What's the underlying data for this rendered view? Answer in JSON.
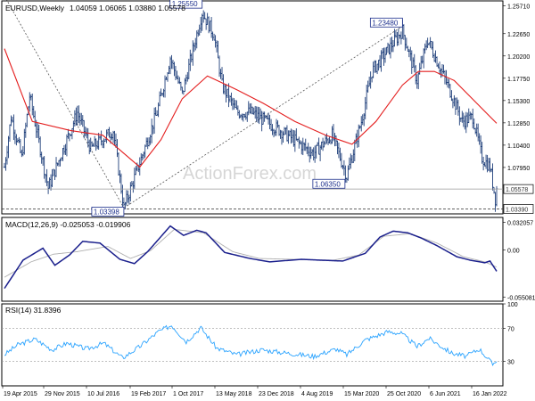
{
  "chart_data": [
    {
      "type": "ohlc",
      "title": "EURUSD,Weekly",
      "ohlc_header": "1.04059 1.06065 1.03880 1.05578",
      "ylim": [
        1.0285,
        1.2625
      ],
      "y_ticks": [
        "1.25710",
        "1.22650",
        "1.20200",
        "1.17750",
        "1.15300",
        "1.12850",
        "1.10400",
        "1.07950"
      ],
      "last_price": "1.05578",
      "horizontal_line": "1.03390",
      "x_ticks": [
        "19 Apr 2015",
        "29 Nov 2015",
        "10 Jul 2016",
        "19 Feb 2017",
        "1 Oct 2017",
        "13 May 2018",
        "23 Dec 2018",
        "4 Aug 2019",
        "15 Mar 2020",
        "25 Oct 2020",
        "6 Jun 2021",
        "16 Jan 2022"
      ],
      "annotations": [
        {
          "label": "1.25550",
          "date": "2018-02-18",
          "value": 1.2555
        },
        {
          "label": "1.23480",
          "date": "2021-01-10",
          "value": 1.2348
        },
        {
          "label": "1.06350",
          "date": "2020-03-22",
          "value": 1.0635
        },
        {
          "label": "1.03398",
          "date": "2017-01-01",
          "value": 1.03398
        }
      ],
      "price_path": [
        [
          "2015-04-12",
          1.08
        ],
        [
          "2015-05-17",
          1.135
        ],
        [
          "2015-07-12",
          1.09
        ],
        [
          "2015-08-23",
          1.158
        ],
        [
          "2015-11-29",
          1.057
        ],
        [
          "2016-05-01",
          1.14
        ],
        [
          "2016-07-10",
          1.1
        ],
        [
          "2016-11-06",
          1.12
        ],
        [
          "2017-01-01",
          1.035
        ],
        [
          "2017-03-26",
          1.085
        ],
        [
          "2017-06-25",
          1.14
        ],
        [
          "2017-09-03",
          1.2
        ],
        [
          "2017-11-05",
          1.16
        ],
        [
          "2018-02-18",
          1.25
        ],
        [
          "2018-04-22",
          1.225
        ],
        [
          "2018-06-03",
          1.17
        ],
        [
          "2018-08-19",
          1.14
        ],
        [
          "2018-11-04",
          1.14
        ],
        [
          "2019-04-07",
          1.12
        ],
        [
          "2019-09-29",
          1.095
        ],
        [
          "2020-01-05",
          1.115
        ],
        [
          "2020-03-22",
          1.07
        ],
        [
          "2020-06-07",
          1.13
        ],
        [
          "2020-08-02",
          1.185
        ],
        [
          "2021-01-10",
          1.23
        ],
        [
          "2021-03-28",
          1.175
        ],
        [
          "2021-05-23",
          1.22
        ],
        [
          "2021-09-26",
          1.16
        ],
        [
          "2021-11-21",
          1.13
        ],
        [
          "2022-01-16",
          1.135
        ],
        [
          "2022-03-06",
          1.09
        ],
        [
          "2022-04-17",
          1.08
        ],
        [
          "2022-05-15",
          1.045
        ],
        [
          "2022-05-22",
          1.05578
        ]
      ],
      "ma_path": [
        [
          "2015-04-12",
          1.21
        ],
        [
          "2015-09-06",
          1.13
        ],
        [
          "2016-03-27",
          1.12
        ],
        [
          "2016-09-11",
          1.115
        ],
        [
          "2017-03-26",
          1.08
        ],
        [
          "2017-07-16",
          1.11
        ],
        [
          "2017-11-05",
          1.155
        ],
        [
          "2018-03-18",
          1.18
        ],
        [
          "2018-08-19",
          1.165
        ],
        [
          "2019-01-06",
          1.15
        ],
        [
          "2019-06-23",
          1.13
        ],
        [
          "2019-12-01",
          1.115
        ],
        [
          "2020-04-19",
          1.105
        ],
        [
          "2020-08-23",
          1.13
        ],
        [
          "2021-01-10",
          1.17
        ],
        [
          "2021-04-04",
          1.185
        ],
        [
          "2021-06-27",
          1.185
        ],
        [
          "2021-10-10",
          1.175
        ],
        [
          "2022-02-06",
          1.15
        ],
        [
          "2022-05-22",
          1.128
        ]
      ],
      "trend_lines": [
        {
          "from": [
            "2015-04-12",
            1.268
          ],
          "to": [
            "2017-01-01",
            1.035
          ]
        },
        {
          "from": [
            "2017-01-01",
            1.035
          ],
          "to": [
            "2021-01-10",
            1.2348
          ]
        }
      ]
    },
    {
      "type": "line",
      "title": "MACD(12,26,9) -0.025053 -0.019906",
      "y_ticks": [
        "0.032057",
        "0.00",
        "-0.055081"
      ],
      "ylim": [
        -0.06,
        0.038
      ],
      "series": [
        {
          "values": [
            [
              "2015-04-12",
              -0.045
            ],
            [
              "2015-07-19",
              -0.012
            ],
            [
              "2015-11-01",
              0.002
            ],
            [
              "2016-01-03",
              -0.018
            ],
            [
              "2016-03-20",
              -0.006
            ],
            [
              "2016-05-29",
              0.01
            ],
            [
              "2016-08-28",
              0.008
            ],
            [
              "2016-12-11",
              -0.011
            ],
            [
              "2017-02-26",
              -0.016
            ],
            [
              "2017-05-07",
              -0.002
            ],
            [
              "2017-09-03",
              0.028
            ],
            [
              "2017-11-12",
              0.017
            ],
            [
              "2018-01-21",
              0.023
            ],
            [
              "2018-03-11",
              0.02
            ],
            [
              "2018-06-17",
              -0.003
            ],
            [
              "2018-10-28",
              -0.01
            ],
            [
              "2019-02-10",
              -0.014
            ],
            [
              "2019-07-28",
              -0.011
            ],
            [
              "2019-11-03",
              -0.012
            ],
            [
              "2020-03-01",
              -0.013
            ],
            [
              "2020-06-28",
              -0.004
            ],
            [
              "2020-09-13",
              0.015
            ],
            [
              "2020-11-22",
              0.022
            ],
            [
              "2021-02-07",
              0.02
            ],
            [
              "2021-04-18",
              0.014
            ],
            [
              "2021-07-11",
              0.005
            ],
            [
              "2021-10-24",
              -0.008
            ],
            [
              "2022-01-02",
              -0.012
            ],
            [
              "2022-03-20",
              -0.015
            ],
            [
              "2022-04-17",
              -0.013
            ],
            [
              "2022-05-22",
              -0.025
            ]
          ]
        },
        {
          "values": [
            [
              "2015-04-12",
              -0.032
            ],
            [
              "2015-08-30",
              -0.014
            ],
            [
              "2015-12-27",
              -0.005
            ],
            [
              "2016-05-01",
              -0.002
            ],
            [
              "2016-10-09",
              0.004
            ],
            [
              "2017-02-05",
              -0.01
            ],
            [
              "2017-05-21",
              -0.001
            ],
            [
              "2017-09-24",
              0.024
            ],
            [
              "2018-02-25",
              0.02
            ],
            [
              "2018-07-29",
              -0.002
            ],
            [
              "2018-12-16",
              -0.01
            ],
            [
              "2019-06-09",
              -0.011
            ],
            [
              "2020-01-12",
              -0.012
            ],
            [
              "2020-05-24",
              -0.006
            ],
            [
              "2020-10-04",
              0.016
            ],
            [
              "2021-02-21",
              0.019
            ],
            [
              "2021-07-11",
              0.008
            ],
            [
              "2021-11-28",
              -0.008
            ],
            [
              "2022-03-20",
              -0.014
            ],
            [
              "2022-05-22",
              -0.02
            ]
          ]
        }
      ]
    },
    {
      "type": "line",
      "title": "RSI(14) 31.8396",
      "y_ticks": [
        "100",
        "70",
        "30",
        "0"
      ],
      "ylim": [
        0,
        100
      ],
      "series": [
        {
          "values": [
            [
              "2015-04-12",
              38
            ],
            [
              "2015-06-21",
              50
            ],
            [
              "2015-09-20",
              57
            ],
            [
              "2015-12-20",
              44
            ],
            [
              "2016-03-06",
              52
            ],
            [
              "2016-06-19",
              45
            ],
            [
              "2016-09-18",
              52
            ],
            [
              "2016-12-25",
              34
            ],
            [
              "2017-03-26",
              48
            ],
            [
              "2017-07-02",
              66
            ],
            [
              "2017-09-10",
              74
            ],
            [
              "2017-11-26",
              54
            ],
            [
              "2018-02-11",
              71
            ],
            [
              "2018-05-06",
              46
            ],
            [
              "2018-08-19",
              38
            ],
            [
              "2018-12-30",
              44
            ],
            [
              "2019-05-12",
              40
            ],
            [
              "2019-09-29",
              36
            ],
            [
              "2020-01-26",
              45
            ],
            [
              "2020-03-22",
              38
            ],
            [
              "2020-06-28",
              56
            ],
            [
              "2020-10-25",
              66
            ],
            [
              "2021-01-03",
              64
            ],
            [
              "2021-03-28",
              48
            ],
            [
              "2021-05-30",
              58
            ],
            [
              "2021-09-26",
              40
            ],
            [
              "2021-12-12",
              36
            ],
            [
              "2022-02-20",
              45
            ],
            [
              "2022-04-10",
              32
            ],
            [
              "2022-05-01",
              26
            ],
            [
              "2022-05-22",
              32
            ]
          ]
        }
      ]
    }
  ],
  "watermark": "ActionForex.com"
}
